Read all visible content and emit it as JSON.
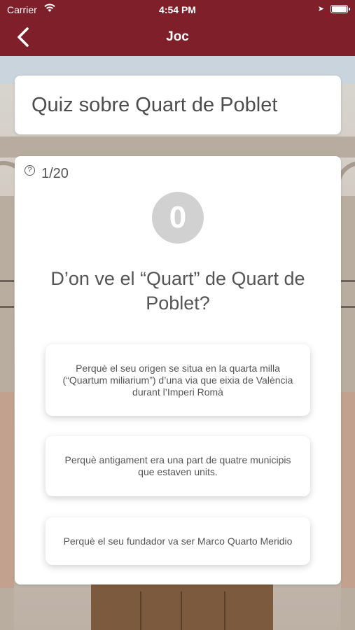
{
  "status_bar": {
    "carrier": "Carrier",
    "time": "4:54 PM"
  },
  "nav": {
    "title": "Joc",
    "back_icon": "chevron-left-icon"
  },
  "quiz_title": "Quiz sobre Quart de Poblet",
  "quiz": {
    "counter_icon": "question-circle-icon",
    "counter": "1/20",
    "score": "0",
    "question": "D’on ve el “Quart” de Quart de Poblet?",
    "answers": [
      "Perquè el seu origen se situa en la quarta milla (“Quartum miliarium”) d’una via que eixia de València durant l’Imperi Romà",
      "Perquè antigament era una part de quatre municipis que estaven units.",
      "Perquè el seu fundador va ser Marco Quarto Meridio"
    ]
  },
  "colors": {
    "header": "#7e1f2a",
    "card": "#ffffff",
    "score_circle": "#d1d1d1",
    "text": "#555555"
  }
}
